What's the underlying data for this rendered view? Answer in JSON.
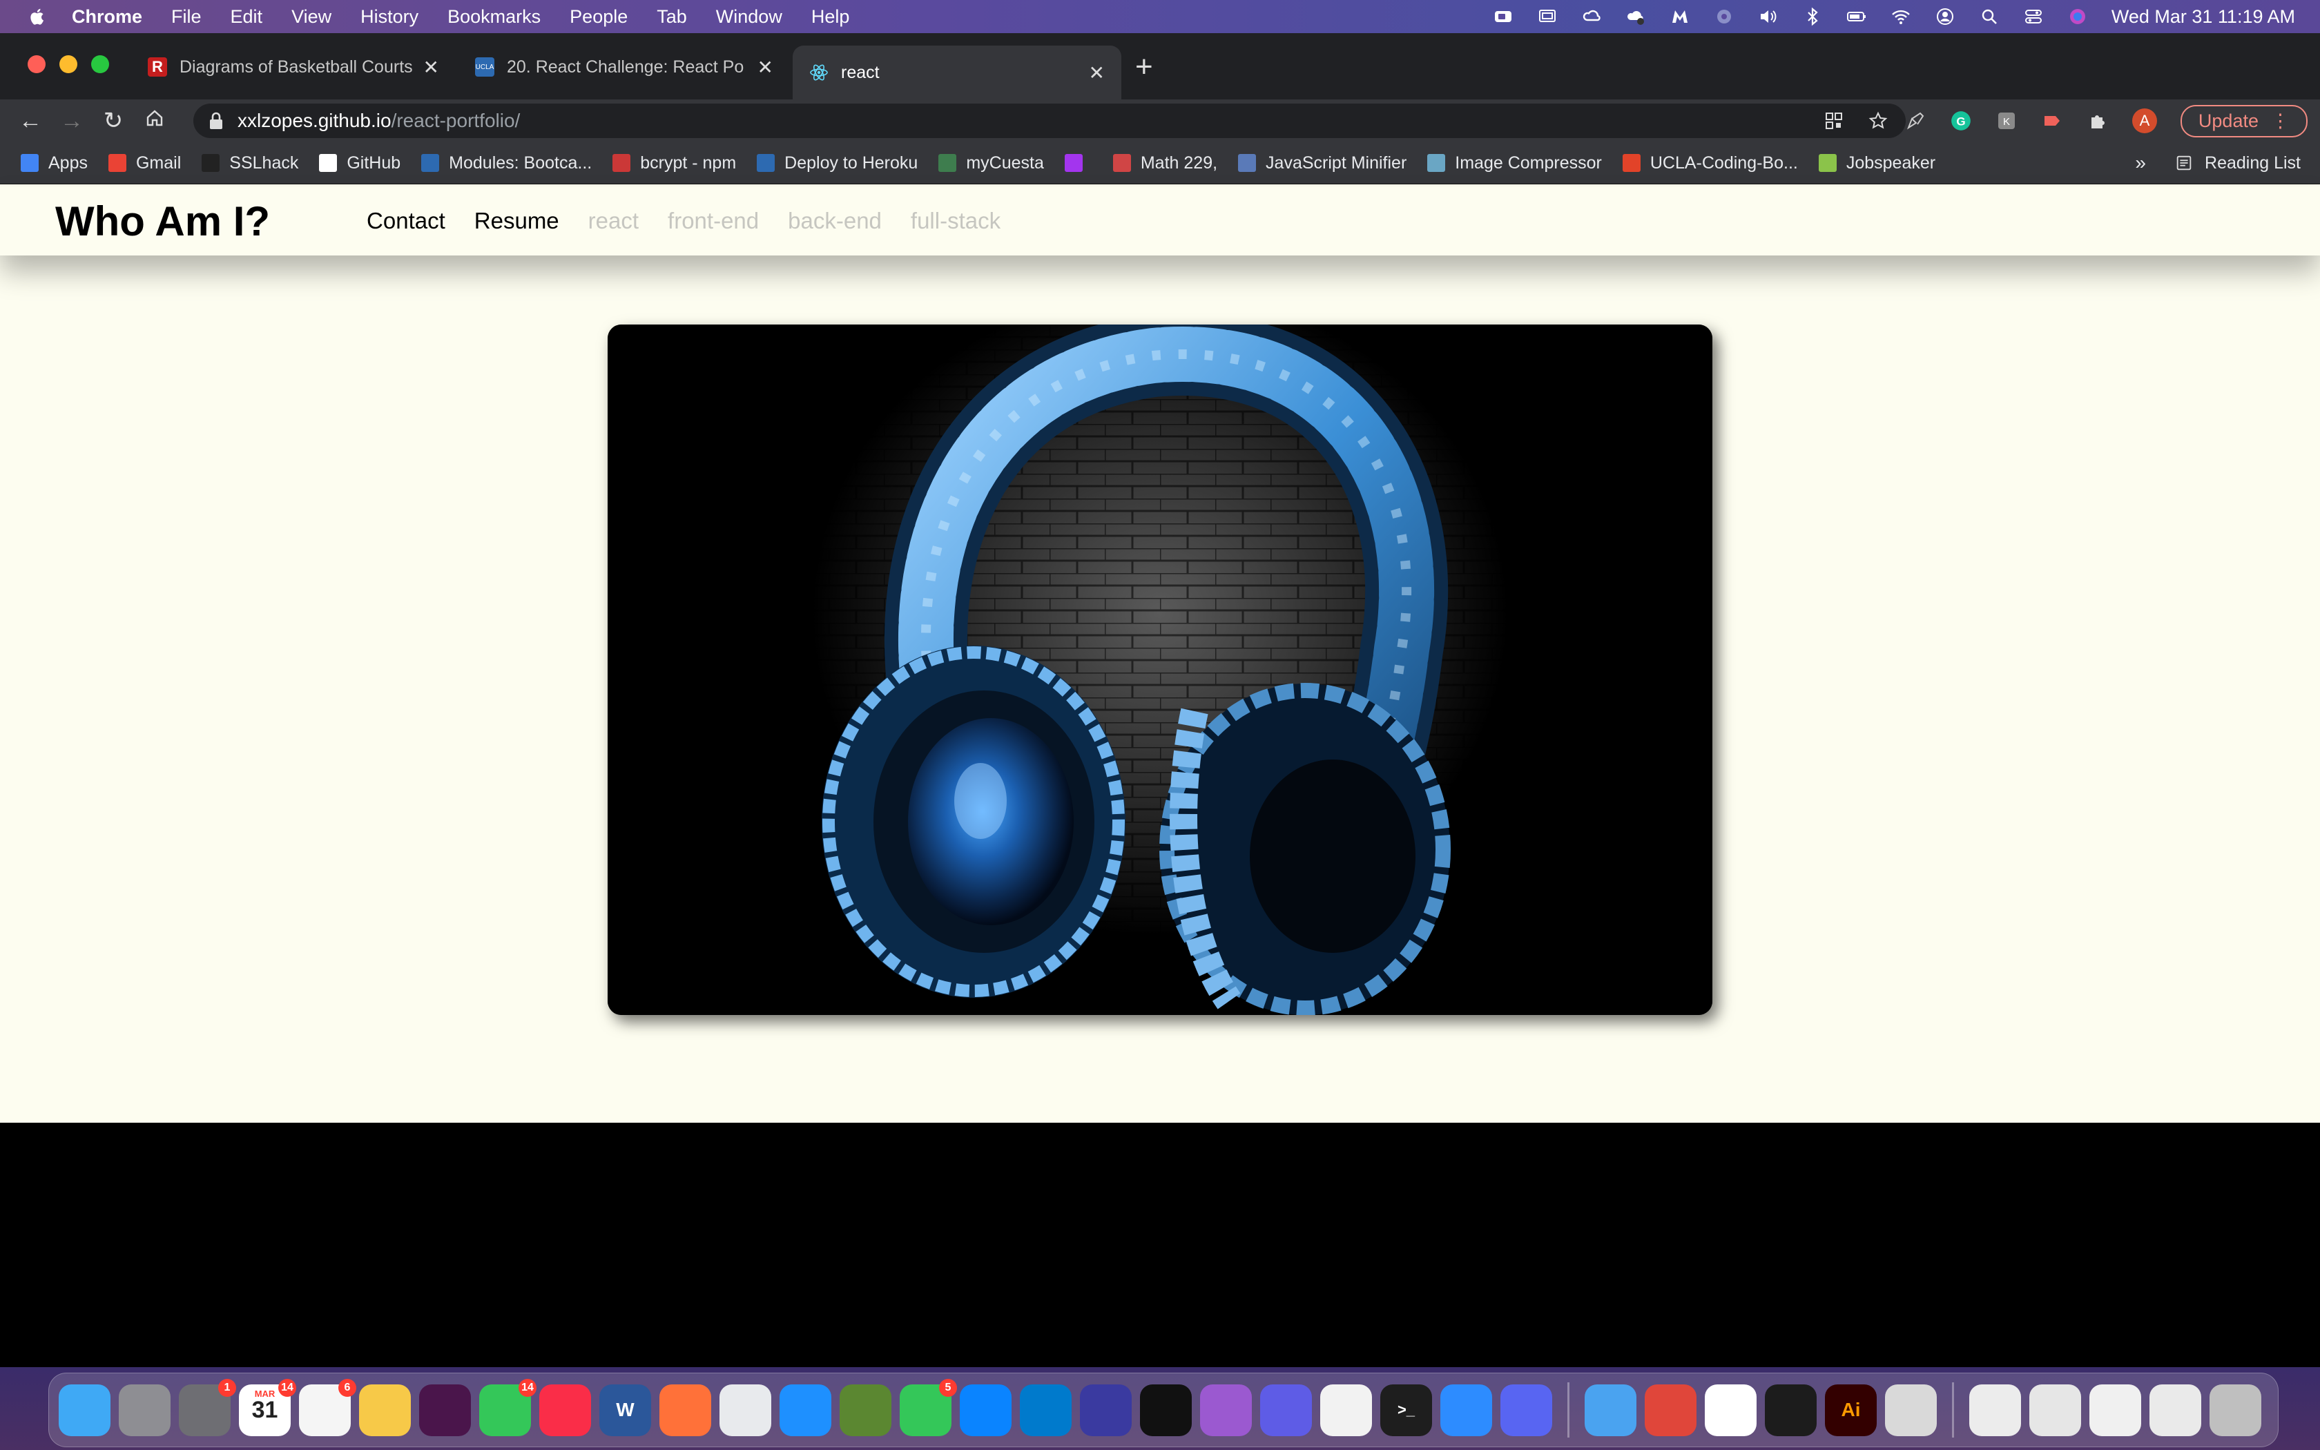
{
  "menubar": {
    "app_name": "Chrome",
    "menus": [
      "File",
      "Edit",
      "View",
      "History",
      "Bookmarks",
      "People",
      "Tab",
      "Window",
      "Help"
    ],
    "datetime": "Wed Mar 31  11:19 AM"
  },
  "tabs": [
    {
      "title": "Diagrams of Basketball Courts",
      "favicon_color": "#c41e1e",
      "active": false
    },
    {
      "title": "20. React Challenge: React Po",
      "favicon_color": "#2d6ab1",
      "active": false
    },
    {
      "title": "react",
      "favicon_color": "#61dafb",
      "active": true
    }
  ],
  "address_bar": {
    "host": "xxlzopes.github.io",
    "path": "/react-portfolio/"
  },
  "toolbar": {
    "avatar_letter": "A",
    "update_label": "Update"
  },
  "bookmarks": [
    {
      "label": "Apps",
      "color": "#4285f4"
    },
    {
      "label": "Gmail",
      "color": "#ea4335"
    },
    {
      "label": "SSLhack",
      "color": "#222222"
    },
    {
      "label": "GitHub",
      "color": "#ffffff"
    },
    {
      "label": "Modules: Bootca...",
      "color": "#2d6ab1"
    },
    {
      "label": "bcrypt - npm",
      "color": "#cb3837"
    },
    {
      "label": "Deploy to Heroku",
      "color": "#2d6ab1"
    },
    {
      "label": "myCuesta",
      "color": "#3e7d4e"
    },
    {
      "label": "",
      "color": "#a335ee"
    },
    {
      "label": "Math 229,",
      "color": "#d04545"
    },
    {
      "label": "JavaScript Minifier",
      "color": "#5a7ab8"
    },
    {
      "label": "Image Compressor",
      "color": "#6aa6c4"
    },
    {
      "label": "UCLA-Coding-Bo...",
      "color": "#e24329"
    },
    {
      "label": "Jobspeaker",
      "color": "#8bc34a"
    }
  ],
  "bookmarks_more": "»",
  "reading_list_label": "Reading List",
  "site": {
    "brand": "Who Am I?",
    "nav": [
      {
        "label": "Contact",
        "active": true
      },
      {
        "label": "Resume",
        "active": true
      },
      {
        "label": "react",
        "active": false
      },
      {
        "label": "front-end",
        "active": false
      },
      {
        "label": "back-end",
        "active": false
      },
      {
        "label": "full-stack",
        "active": false
      }
    ]
  },
  "dock": {
    "icons": [
      {
        "name": "finder",
        "color": "#3fa9f5",
        "badge": ""
      },
      {
        "name": "launchpad",
        "color": "#8e8e93",
        "badge": ""
      },
      {
        "name": "system-preferences",
        "color": "#6e6e73",
        "badge": "1"
      },
      {
        "name": "calendar",
        "color": "#ffffff",
        "badge": "14",
        "text": "31",
        "month": "MAR"
      },
      {
        "name": "reminders",
        "color": "#f5f5f5",
        "badge": "6"
      },
      {
        "name": "photos",
        "color": "#f7c948",
        "badge": ""
      },
      {
        "name": "slack",
        "color": "#4a154b",
        "badge": ""
      },
      {
        "name": "facetime",
        "color": "#34c759",
        "badge": "14"
      },
      {
        "name": "music",
        "color": "#fa2d48",
        "badge": ""
      },
      {
        "name": "word",
        "color": "#2b579a",
        "badge": "",
        "text": "W"
      },
      {
        "name": "firefox",
        "color": "#ff7139",
        "badge": ""
      },
      {
        "name": "chrome",
        "color": "#e8eaed",
        "badge": ""
      },
      {
        "name": "safari",
        "color": "#1e90ff",
        "badge": ""
      },
      {
        "name": "minecraft",
        "color": "#5b8731",
        "badge": ""
      },
      {
        "name": "messages",
        "color": "#34c759",
        "badge": "5"
      },
      {
        "name": "app-store",
        "color": "#0a84ff",
        "badge": ""
      },
      {
        "name": "vscode",
        "color": "#007acc",
        "badge": ""
      },
      {
        "name": "night-owl",
        "color": "#3a3aa0",
        "badge": ""
      },
      {
        "name": "hyper",
        "color": "#111111",
        "badge": ""
      },
      {
        "name": "podcasts",
        "color": "#9b59d0",
        "badge": ""
      },
      {
        "name": "siri",
        "color": "#5e5ce6",
        "badge": ""
      },
      {
        "name": "textedit",
        "color": "#f2f2f2",
        "badge": ""
      },
      {
        "name": "terminal",
        "color": "#1e1e1e",
        "badge": "",
        "text": ">_"
      },
      {
        "name": "zoom",
        "color": "#2d8cff",
        "badge": ""
      },
      {
        "name": "discord",
        "color": "#5865f2",
        "badge": ""
      },
      {
        "name": "mail",
        "color": "#4aa3f0",
        "badge": ""
      },
      {
        "name": "airmail",
        "color": "#e0463a",
        "badge": ""
      },
      {
        "name": "mongodb-compass",
        "color": "#ffffff",
        "badge": ""
      },
      {
        "name": "activity-monitor",
        "color": "#1c1c1c",
        "badge": ""
      },
      {
        "name": "illustrator",
        "color": "#330000",
        "badge": "",
        "text": "Ai"
      },
      {
        "name": "preview",
        "color": "#d9d9d9",
        "badge": ""
      },
      {
        "name": "document-1",
        "color": "#ececec",
        "badge": ""
      },
      {
        "name": "document-2",
        "color": "#e6e6e6",
        "badge": ""
      },
      {
        "name": "document-3",
        "color": "#f0f0f0",
        "badge": ""
      },
      {
        "name": "document-4",
        "color": "#eaeaea",
        "badge": ""
      },
      {
        "name": "trash",
        "color": "#bfbfbf",
        "badge": ""
      }
    ]
  }
}
